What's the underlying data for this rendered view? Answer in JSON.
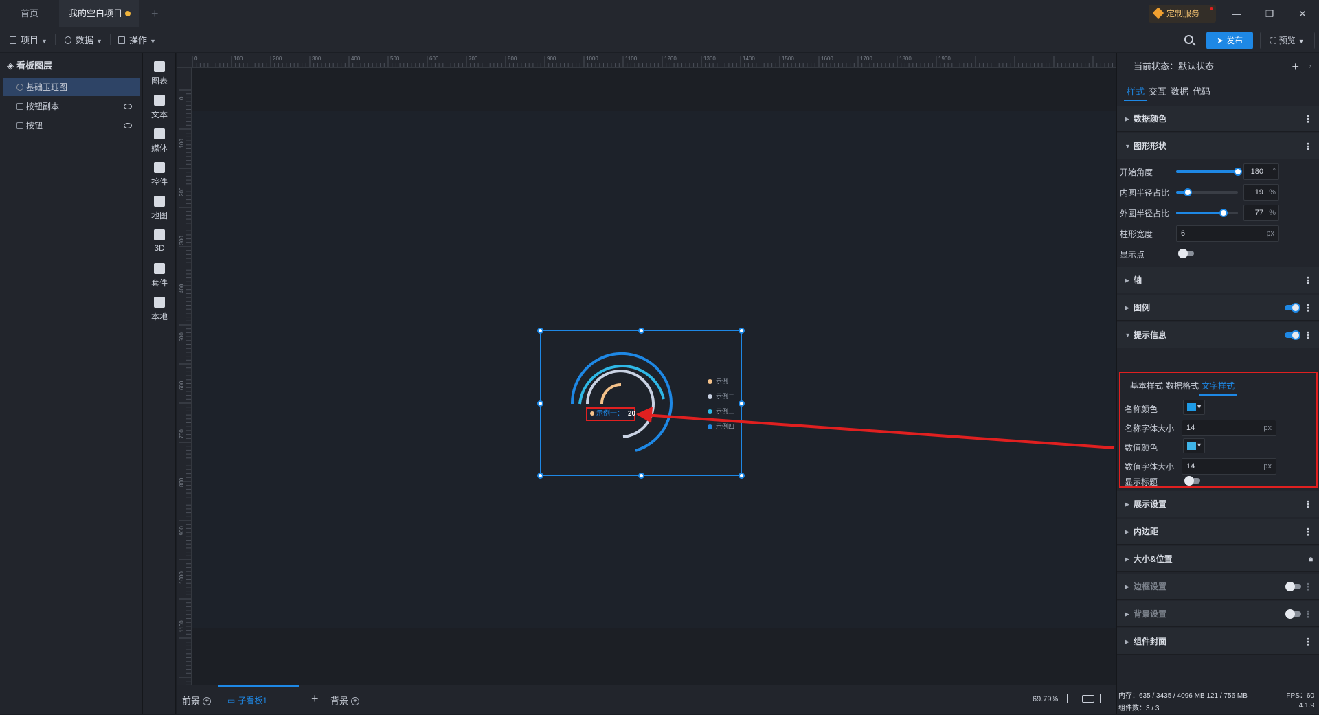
{
  "titlebar": {
    "tabs": [
      {
        "label": "首页"
      },
      {
        "label": "我的空白项目"
      }
    ],
    "add_tab": "+",
    "custom_service": "定制服务",
    "window_buttons": {
      "minimize": "—",
      "restore": "❐",
      "close": "✕"
    }
  },
  "toolbar": {
    "menus": [
      {
        "label": "项目"
      },
      {
        "label": "数据"
      },
      {
        "label": "操作"
      }
    ],
    "publish": "发布",
    "preview": "预览"
  },
  "layers": {
    "title": "看板图层",
    "items": [
      {
        "label": "基础玉珏图",
        "selected": true
      },
      {
        "label": "按钮副本"
      },
      {
        "label": "按钮"
      }
    ]
  },
  "components": [
    {
      "label": "图表",
      "icon": "bar-chart-icon"
    },
    {
      "label": "文本",
      "icon": "text-icon"
    },
    {
      "label": "媒体",
      "icon": "media-icon"
    },
    {
      "label": "控件",
      "icon": "widget-icon"
    },
    {
      "label": "地图",
      "icon": "map-icon"
    },
    {
      "label": "3D",
      "icon": "cube-icon"
    },
    {
      "label": "套件",
      "icon": "suite-icon"
    },
    {
      "label": "本地",
      "icon": "puzzle-icon"
    }
  ],
  "ruler": {
    "h_ticks": [
      "0",
      "100",
      "200",
      "300",
      "400",
      "500",
      "600",
      "700",
      "800",
      "900",
      "1000",
      "1100",
      "1200",
      "1300",
      "1400",
      "1500",
      "1600",
      "1700",
      "1800",
      "1900"
    ],
    "v_ticks": [
      "0",
      "100",
      "200",
      "300",
      "400",
      "500",
      "600",
      "700",
      "800",
      "900",
      "1000",
      "1100"
    ]
  },
  "widget": {
    "tooltip": {
      "name": "示例一：",
      "value": "20"
    },
    "legend": [
      {
        "label": "示例一",
        "color": "#f5c28a"
      },
      {
        "label": "示例二",
        "color": "#c9d2e3"
      },
      {
        "label": "示例三",
        "color": "#2fb8e6"
      },
      {
        "label": "示例四",
        "color": "#1e88e5"
      }
    ]
  },
  "bottom": {
    "foreground": "前景",
    "sub_board": "子看板1",
    "add": "+",
    "background": "背景",
    "zoom": "69.79%"
  },
  "props": {
    "state_label": "当前状态：默认状态",
    "tabs": [
      {
        "label": "样式"
      },
      {
        "label": "交互"
      },
      {
        "label": "数据"
      },
      {
        "label": "代码"
      }
    ],
    "sections": {
      "data_color": "数据颜色",
      "shape": "图形形状",
      "axis": "轴",
      "legend": "图例",
      "tooltip": "提示信息",
      "display": "展示设置",
      "padding": "内边距",
      "size_pos": "大小&位置",
      "border": "边框设置",
      "bg": "背景设置",
      "cover": "组件封面"
    },
    "shape": {
      "start_angle": {
        "label": "开始角度",
        "value": "180",
        "unit": "°",
        "fraction": 1.0
      },
      "inner_ratio": {
        "label": "内圆半径占比",
        "value": "19",
        "unit": "%",
        "fraction": 0.19
      },
      "outer_ratio": {
        "label": "外圆半径占比",
        "value": "77",
        "unit": "%",
        "fraction": 0.77
      },
      "bar_width": {
        "label": "柱形宽度",
        "value": "6",
        "unit": "px"
      },
      "show_point": {
        "label": "显示点"
      }
    },
    "tooltip_panel": {
      "subtabs": [
        {
          "label": "基本样式"
        },
        {
          "label": "数据格式"
        },
        {
          "label": "文字样式"
        }
      ],
      "name_color": {
        "label": "名称颜色",
        "color": "#1e9ae5"
      },
      "name_size": {
        "label": "名称字体大小",
        "value": "14",
        "unit": "px"
      },
      "value_color": {
        "label": "数值颜色",
        "color": "#3fb4e8"
      },
      "value_size": {
        "label": "数值字体大小",
        "value": "14",
        "unit": "px"
      },
      "show_title": {
        "label": "显示标题"
      }
    },
    "status": {
      "memory": "内存：635 / 3435 / 4096 MB  121 / 756 MB",
      "fps": "FPS：60",
      "count": "组件数：3 / 3",
      "version": "4.1.9"
    }
  }
}
